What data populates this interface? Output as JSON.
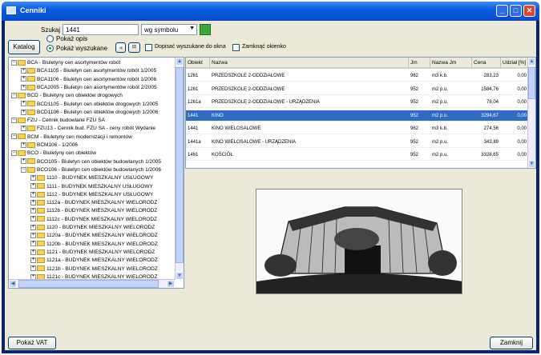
{
  "window": {
    "title": "Cenniki"
  },
  "search": {
    "label": "Szukaj",
    "value": "1441",
    "mode": "wg symbolu"
  },
  "katalog_button": "Katalog",
  "view_options": {
    "all_label": "Pokaż opis",
    "found_label": "Pokaż wyszukane",
    "selected": "found"
  },
  "checkboxes": {
    "add_to_list": "Dopisać wyszukane do okna",
    "close_window": "Zamknąć okienko"
  },
  "tree": {
    "items": [
      {
        "level": 0,
        "expanded": true,
        "text": "BCA - Biuletyny cen asortymentów robót"
      },
      {
        "level": 1,
        "expanded": false,
        "text": "BCA1105 - Biuletyn cen asortymentów robót 1/2005"
      },
      {
        "level": 1,
        "expanded": false,
        "text": "BCA1106 - Biuletyn cen asortymentów robót 1/2006"
      },
      {
        "level": 1,
        "expanded": false,
        "text": "BCA2005 - Biuletyn cen asortymentów robót 2/2005"
      },
      {
        "level": 0,
        "expanded": true,
        "text": "BCD - Biuletyny cen obiektów drogowych"
      },
      {
        "level": 1,
        "expanded": false,
        "text": "BCD1105 - Biuletyn cen obiektów drogowych 1/2005"
      },
      {
        "level": 1,
        "expanded": false,
        "text": "BCD1106 - Biuletyn cen obiektów drogowych 1/2006"
      },
      {
        "level": 0,
        "expanded": true,
        "text": "FZU - Cennik budowlane FZU SA"
      },
      {
        "level": 1,
        "expanded": false,
        "text": "FZU13 - Cennik bud. FZU SA - ceny robót Wydanie"
      },
      {
        "level": 0,
        "expanded": true,
        "text": "BCM - Biuletyny cen modernizacji i remontów"
      },
      {
        "level": 1,
        "expanded": false,
        "text": "BCM106 - 1/2006"
      },
      {
        "level": 0,
        "expanded": true,
        "text": "BCO - Biuletyny cen obiektów"
      },
      {
        "level": 1,
        "expanded": false,
        "text": "BCO105 - Biuletyn cen obiektów budowlanych 1/2005"
      },
      {
        "level": 1,
        "expanded": true,
        "text": "BCO106 - Biuletyn cen obiektów budowlanych 1/2006"
      },
      {
        "level": 2,
        "expanded": false,
        "text": "1110 - BUDYNEK MIESZKALNY USŁUGOWY"
      },
      {
        "level": 2,
        "expanded": false,
        "text": "1111 - BUDYNEK MIESZKALNY USŁUGOWY"
      },
      {
        "level": 2,
        "expanded": false,
        "text": "1112 - BUDYNEK MIESZKALNY USŁUGOWY"
      },
      {
        "level": 2,
        "expanded": false,
        "text": "1112a - BUDYNEK MIESZKALNY WIELORODZ"
      },
      {
        "level": 2,
        "expanded": false,
        "text": "1112b - BUDYNEK MIESZKALNY WIELORODZ"
      },
      {
        "level": 2,
        "expanded": false,
        "text": "1112c - BUDYNEK MIESZKALNY WIELORODZ"
      },
      {
        "level": 2,
        "expanded": false,
        "text": "1120 - BUDYNEK MIESZKALNY WIELORODZ"
      },
      {
        "level": 2,
        "expanded": false,
        "text": "1120a - BUDYNEK MIESZKALNY WIELORODZ"
      },
      {
        "level": 2,
        "expanded": false,
        "text": "1120b - BUDYNEK MIESZKALNY WIELORODZ"
      },
      {
        "level": 2,
        "expanded": false,
        "text": "1121 - BUDYNEK MIESZKALNY WIELORODZ"
      },
      {
        "level": 2,
        "expanded": false,
        "text": "1121a - BUDYNEK MIESZKALNY WIELORODZ"
      },
      {
        "level": 2,
        "expanded": false,
        "text": "1121b - BUDYNEK MIESZKALNY WIELORODZ"
      },
      {
        "level": 2,
        "expanded": false,
        "text": "1121c - BUDYNEK MIESZKALNY WIELORODZ"
      }
    ]
  },
  "table": {
    "columns": [
      "Obiekt",
      "Nazwa",
      "Jm",
      "Nazwa Jm",
      "Cena",
      "Udział [%]"
    ],
    "rows": [
      [
        "1261",
        "PRZEDSZKOLE 2-ODDZIAŁOWE",
        "962",
        "m3 k.b.",
        "283,23",
        "0,00"
      ],
      [
        "1261",
        "PRZEDSZKOLE 2-ODDZIAŁOWE",
        "952",
        "m2 p.u.",
        "1584,76",
        "0,00"
      ],
      [
        "1261a",
        "PRZEDSZKOLE 2-ODDZIAŁOWE - URZĄDZENIA",
        "952",
        "m2 p.u.",
        "78,04",
        "0,00"
      ],
      [
        "1441",
        "KINO",
        "952",
        "m2 p.u.",
        "3294,67",
        "0,00"
      ],
      [
        "1441",
        "KINO WIELOSALOWE",
        "962",
        "m3 k.b.",
        "274,56",
        "0,00"
      ],
      [
        "1441a",
        "KINO WIELOSALOWE - URZĄDZENIA",
        "952",
        "m2 p.u.",
        "343,89",
        "0,00"
      ],
      [
        "1461",
        "KOŚCIÓŁ",
        "952",
        "m2 p.u.",
        "3328,65",
        "0,00"
      ]
    ],
    "selected_row": 3
  },
  "footer": {
    "vat_button": "Pokaż VAT",
    "close_button": "Zamknij"
  },
  "colors": {
    "selection": "#316ac5",
    "title_bar": "#0a5be0",
    "close_button": "#e0442a"
  }
}
